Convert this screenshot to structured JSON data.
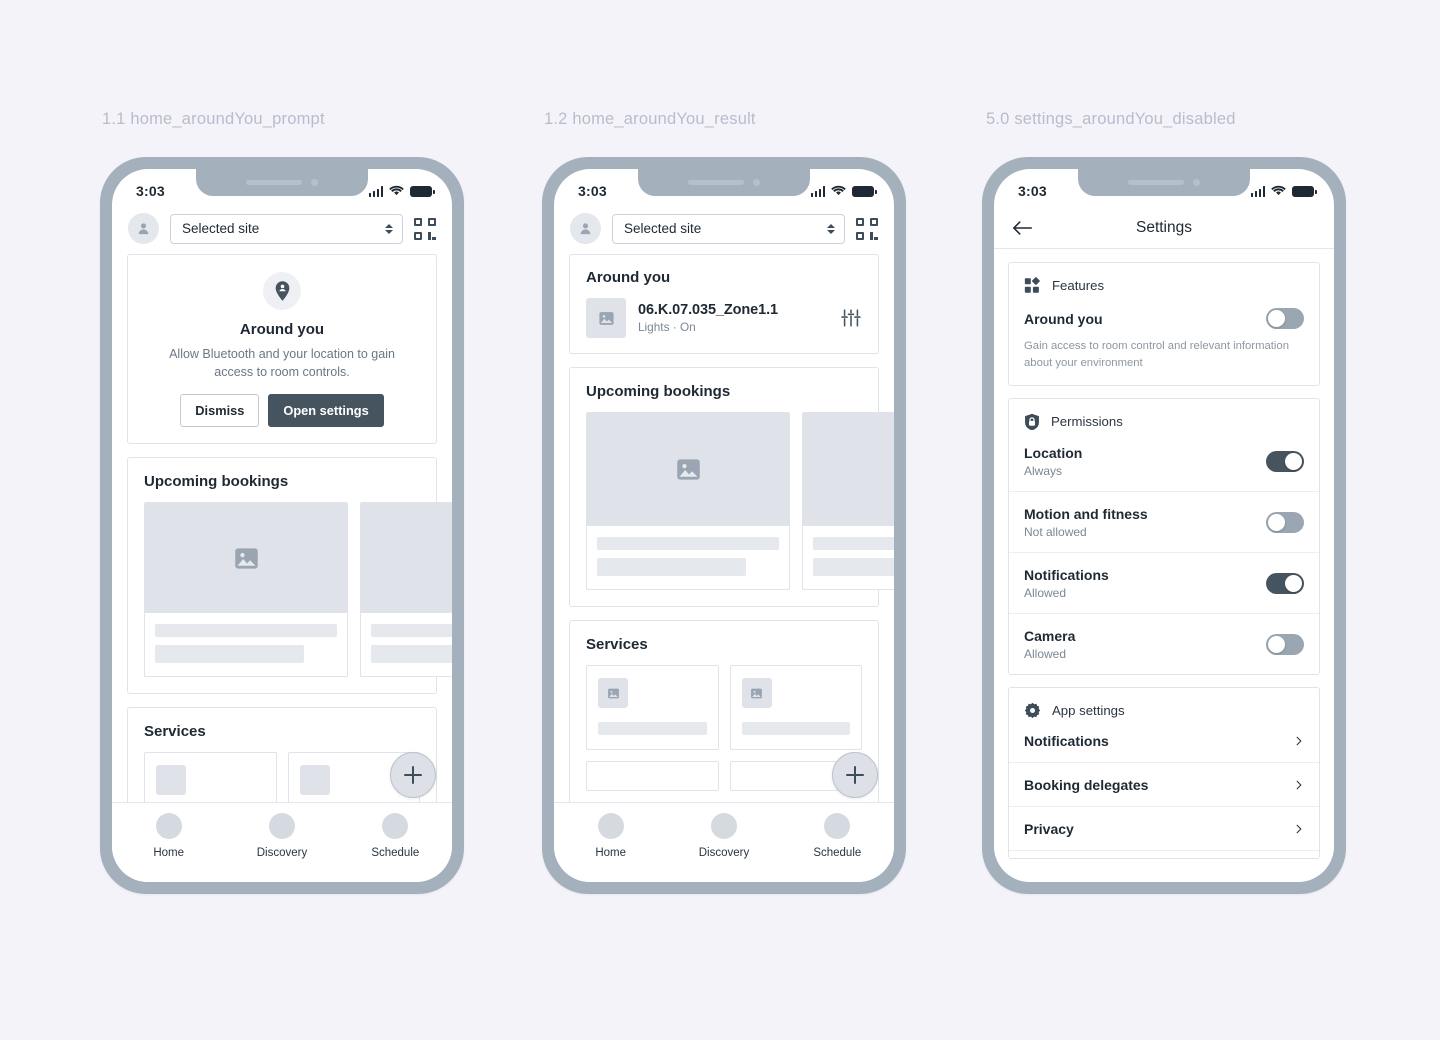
{
  "canvas": {
    "background": "#f3f3f9",
    "frame_color": "#a4b0bc"
  },
  "screens": [
    {
      "caption": "1.1 home_aroundYou_prompt",
      "statusbar": {
        "time": "3:03"
      },
      "topbar": {
        "site_value": "Selected site",
        "avatar_icon": "person-icon",
        "qr_icon": "qr-code-icon"
      },
      "prompt": {
        "icon": "location-pin-person-icon",
        "title": "Around you",
        "description": "Allow Bluetooth and your location to gain access to room controls.",
        "dismiss_label": "Dismiss",
        "open_settings_label": "Open settings"
      },
      "bookings": {
        "title": "Upcoming bookings"
      },
      "services": {
        "title": "Services"
      },
      "fab": {
        "icon": "plus-icon"
      },
      "tabs": [
        {
          "label": "Home"
        },
        {
          "label": "Discovery"
        },
        {
          "label": "Schedule"
        }
      ]
    },
    {
      "caption": "1.2 home_aroundYou_result",
      "statusbar": {
        "time": "3:03"
      },
      "topbar": {
        "site_value": "Selected site",
        "avatar_icon": "person-icon",
        "qr_icon": "qr-code-icon"
      },
      "around": {
        "title": "Around you",
        "item_name": "06.K.07.035_Zone1.1",
        "item_sub": "Lights · On",
        "control_icon": "sliders-icon",
        "thumb_icon": "image-placeholder-icon"
      },
      "bookings": {
        "title": "Upcoming bookings"
      },
      "services": {
        "title": "Services"
      },
      "fab": {
        "icon": "plus-icon"
      },
      "tabs": [
        {
          "label": "Home"
        },
        {
          "label": "Discovery"
        },
        {
          "label": "Schedule"
        }
      ]
    },
    {
      "caption": "5.0 settings_aroundYou_disabled",
      "statusbar": {
        "time": "3:03"
      },
      "nav": {
        "title": "Settings",
        "back_icon": "arrow-left-icon"
      },
      "sections": [
        {
          "icon": "features-grid-icon",
          "label": "Features",
          "rows": [
            {
              "name": "Around you",
              "sub": "",
              "description": "Gain access to room control and relevant information about your environment",
              "toggle": "off"
            }
          ]
        },
        {
          "icon": "permissions-lock-icon",
          "label": "Permissions",
          "rows": [
            {
              "name": "Location",
              "sub": "Always",
              "toggle": "on"
            },
            {
              "name": "Motion and fitness",
              "sub": "Not allowed",
              "toggle": "off"
            },
            {
              "name": "Notifications",
              "sub": "Allowed",
              "toggle": "on"
            },
            {
              "name": "Camera",
              "sub": "Allowed",
              "toggle": "off"
            }
          ]
        },
        {
          "icon": "gear-icon",
          "label": "App settings",
          "rows": [
            {
              "name": "Notifications",
              "chevron": "chevron-right-icon"
            },
            {
              "name": "Booking delegates",
              "chevron": "chevron-right-icon"
            },
            {
              "name": "Privacy",
              "chevron": "chevron-right-icon"
            }
          ]
        }
      ]
    }
  ]
}
